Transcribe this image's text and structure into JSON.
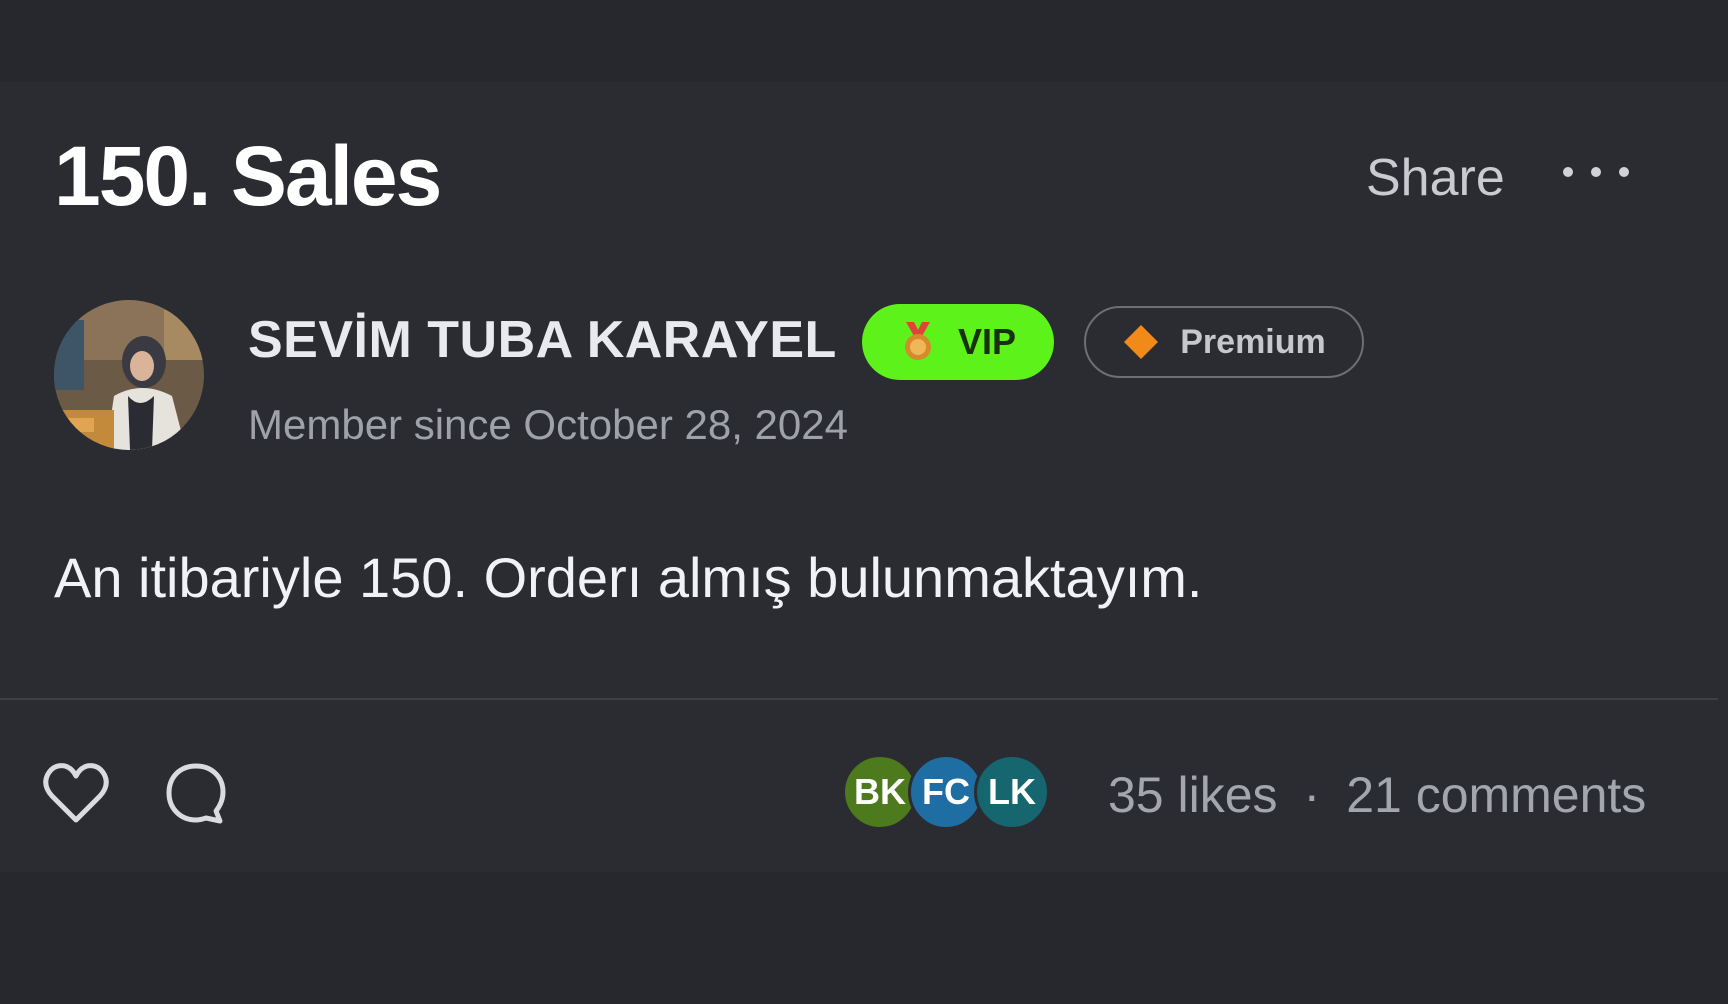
{
  "post": {
    "title": "150. Sales",
    "share_label": "Share",
    "body": "An itibariyle 150. Orderı almış bulunmaktayım."
  },
  "author": {
    "name": "SEVİM TUBA KARAYEL",
    "member_since": "Member since October 28, 2024",
    "badges": {
      "vip": {
        "label": "VIP",
        "icon": "medal-icon",
        "color": "#5cf21a"
      },
      "premium": {
        "label": "Premium",
        "icon": "diamond-icon",
        "color": "#f28a1a"
      }
    }
  },
  "engagement": {
    "likers": [
      {
        "initials": "BK",
        "color": "#4d7a1c"
      },
      {
        "initials": "FC",
        "color": "#1f6ea3"
      },
      {
        "initials": "LK",
        "color": "#15666e"
      }
    ],
    "likes_text": "35 likes",
    "separator": "·",
    "comments_text": "21 comments"
  },
  "icons": {
    "like": "heart-icon",
    "comment": "comment-bubble-icon",
    "more": "more-dots-icon"
  },
  "colors": {
    "background": "#26282d",
    "card": "#2a2c31",
    "vip_green": "#5cf21a",
    "premium_orange": "#f28a1a"
  }
}
